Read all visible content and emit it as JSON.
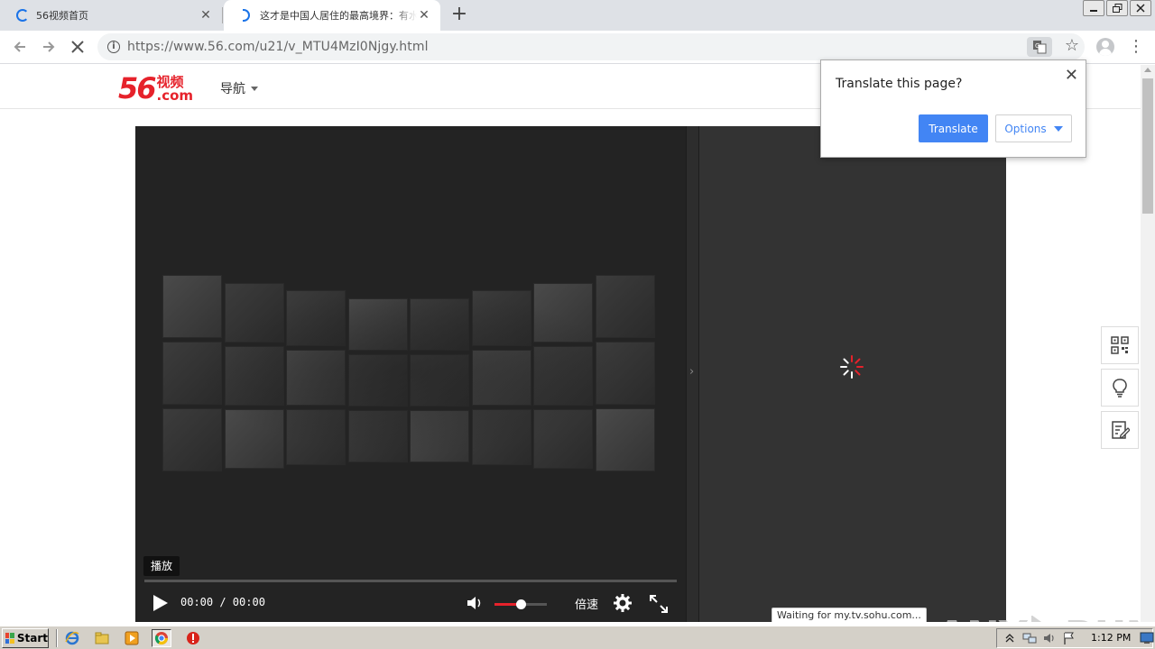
{
  "browser": {
    "tabs": [
      {
        "title": "56视频首页",
        "state": "loading"
      },
      {
        "title": "这才是中国人居住的最高境界：有水有",
        "state": "loading"
      }
    ],
    "new_tab_label": "+",
    "url": "https://www.56.com/u21/v_MTU4MzI0Njgy.html",
    "window_controls": [
      "minimize",
      "restore",
      "close"
    ]
  },
  "site": {
    "logo_number": "56",
    "logo_cn": "视频",
    "logo_com": ".com",
    "nav_label": "导航"
  },
  "player": {
    "tooltip": "播放",
    "time": "00:00 / 00:00",
    "speed_label": "倍速",
    "progress": 0,
    "volume": 0.5
  },
  "translate_popup": {
    "title": "Translate this page?",
    "translate_label": "Translate",
    "options_label": "Options"
  },
  "status_text": "Waiting for my.tv.sohu.com...",
  "watermark": {
    "left": "ANY",
    "right": "RUN"
  },
  "taskbar": {
    "start_label": "Start",
    "clock": "1:12 PM"
  },
  "colors": {
    "brand_red": "#e6222b",
    "chrome_blue": "#4285f4",
    "player_bg": "#232323",
    "side_panel_bg": "#333333"
  }
}
